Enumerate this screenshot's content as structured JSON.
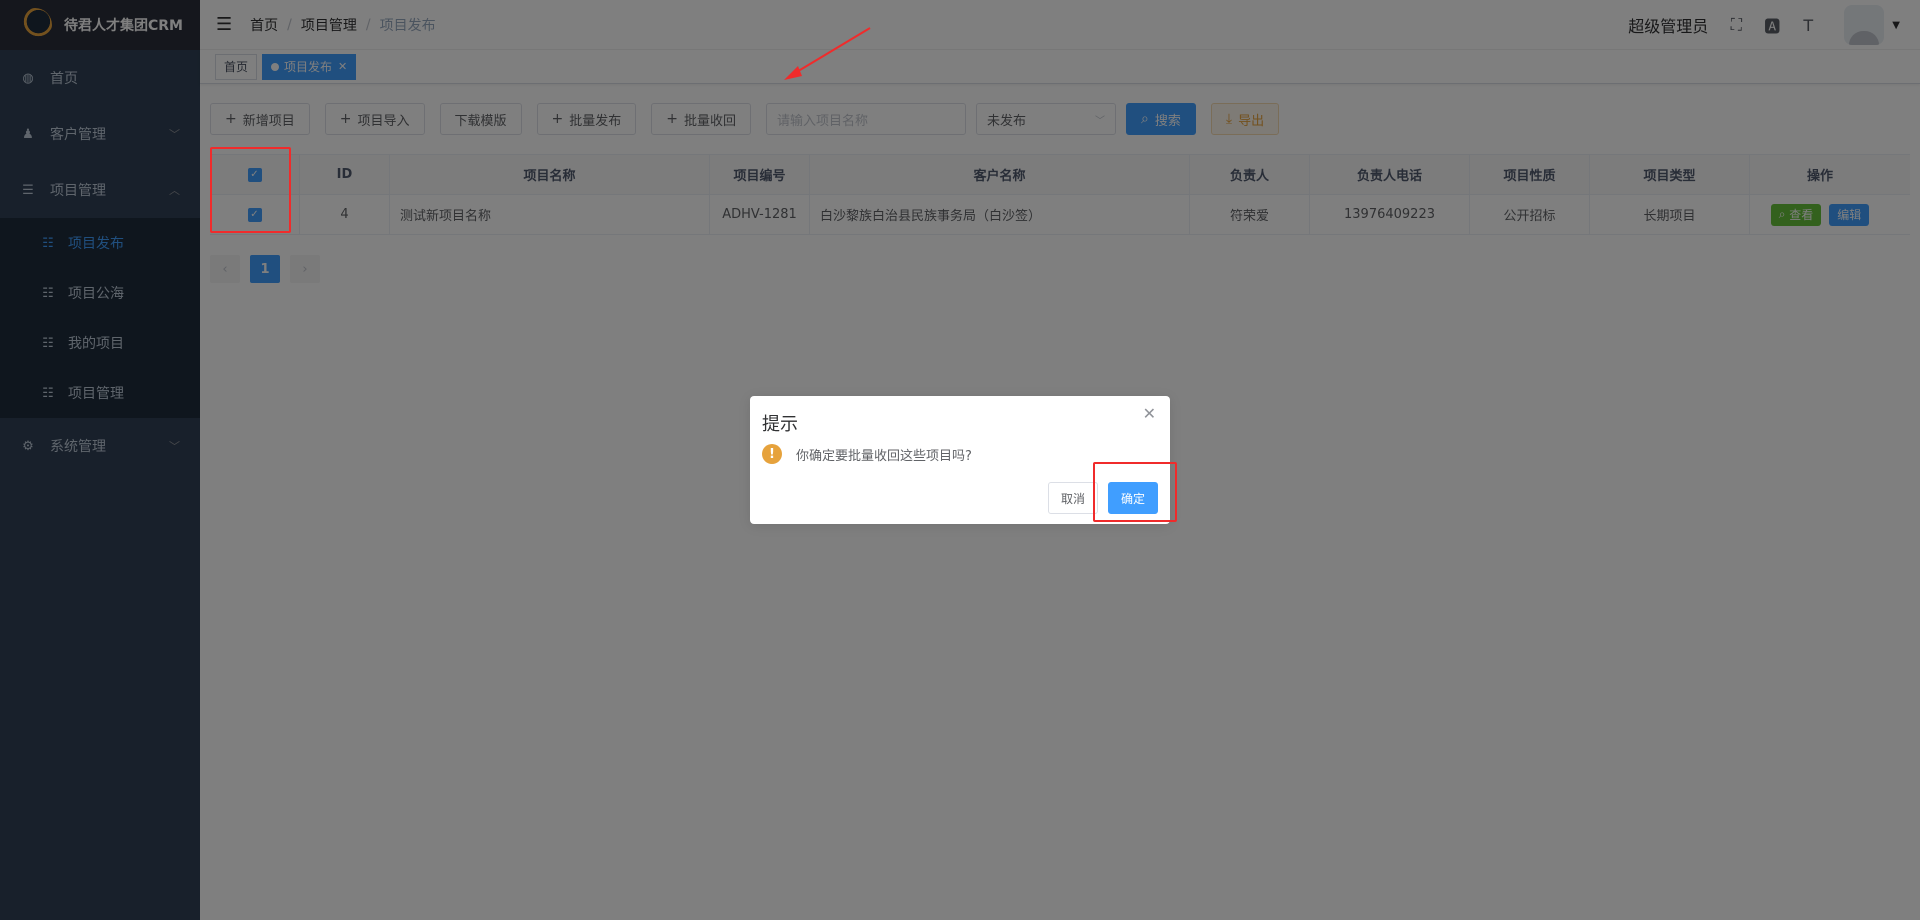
{
  "app": {
    "title": "待君人才集团CRM"
  },
  "sidebar": {
    "items": [
      {
        "label": "首页",
        "icon": "dashboard-icon"
      },
      {
        "label": "客户管理",
        "icon": "users-icon"
      },
      {
        "label": "项目管理",
        "icon": "list-icon"
      }
    ],
    "sub_items": [
      {
        "label": "项目发布"
      },
      {
        "label": "项目公海"
      },
      {
        "label": "我的项目"
      },
      {
        "label": "项目管理"
      }
    ],
    "system": {
      "label": "系统管理",
      "icon": "sliders-icon"
    }
  },
  "navbar": {
    "breadcrumb": [
      "首页",
      "项目管理",
      "项目发布"
    ],
    "user": "超级管理员"
  },
  "tags": {
    "home": "首页",
    "active": "项目发布"
  },
  "toolbar": {
    "add": "新增项目",
    "import": "项目导入",
    "download": "下载模版",
    "batch_publish": "批量发布",
    "batch_recall": "批量收回",
    "search_placeholder": "请输入项目名称",
    "status_select": "未发布",
    "search": "搜索",
    "export": "导出"
  },
  "table": {
    "headers": [
      "ID",
      "项目名称",
      "项目编号",
      "客户名称",
      "负责人",
      "负责人电话",
      "项目性质",
      "项目类型",
      "操作"
    ],
    "rows": [
      {
        "id": "4",
        "name": "测试新项目名称",
        "code": "ADHV-1281",
        "customer": "白沙黎族白治县民族事务局（白沙签）",
        "owner": "符荣爱",
        "phone": "13976409223",
        "nature": "公开招标",
        "type": "长期项目",
        "view": "查看",
        "edit": "编辑"
      }
    ]
  },
  "pagination": {
    "current": "1"
  },
  "dialog": {
    "title": "提示",
    "message": "你确定要批量收回这些项目吗?",
    "cancel": "取消",
    "confirm": "确定"
  },
  "colors": {
    "primary": "#409eff",
    "sidebar_bg": "#304156",
    "warning": "#e6a23c",
    "success": "#67c23a",
    "annotation": "#f02b2b"
  }
}
